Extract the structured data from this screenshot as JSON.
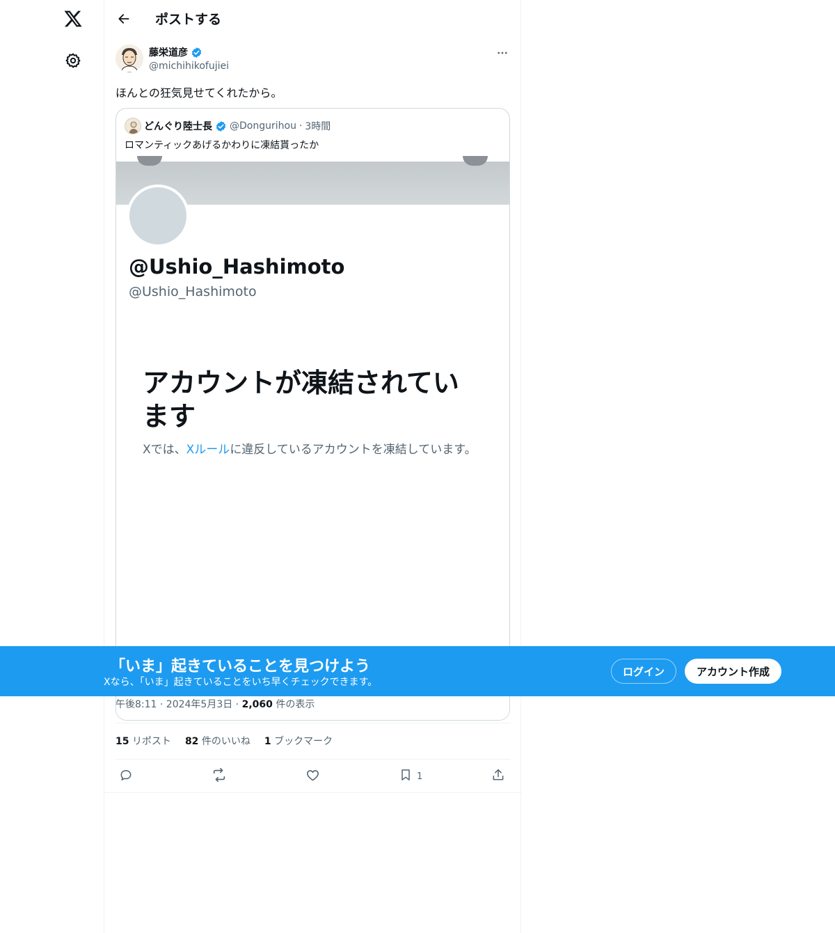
{
  "header": {
    "title": "ポストする"
  },
  "post": {
    "author_name": "藤栄道彦",
    "author_handle": "@michihikofujiei",
    "text": "ほんとの狂気見せてくれたから。",
    "timestamp": "午後8:11 · 2024年5月3日",
    "views_count": "2,060",
    "views_label": "件の表示",
    "reposts_count": "15",
    "reposts_label": "リポスト",
    "likes_count": "82",
    "likes_label": "件のいいね",
    "bookmarks_count": "1",
    "bookmarks_label": "ブックマーク",
    "bookmark_action_count": "1"
  },
  "quote": {
    "author_name": "どんぐり陸士長",
    "author_handle": "@Dongurihou",
    "separator": "·",
    "time": "3時間",
    "text": "ロマンティックあげるかわりに凍結貰ったか",
    "image": {
      "profile_name": "@Ushio_Hashimoto",
      "profile_handle": "@Ushio_Hashimoto",
      "suspended_title": "アカウントが凍結されています",
      "desc_prefix": "Xでは、",
      "desc_link": "Xルール",
      "desc_suffix": "に違反しているアカウントを凍結しています。"
    }
  },
  "login_bar": {
    "title": "「いま」起きていることを見つけよう",
    "subtitle": "Xなら、「いま」起きていることをいち早くチェックできます。",
    "login_label": "ログイン",
    "signup_label": "アカウント作成"
  },
  "colors": {
    "accent": "#1d9bf0",
    "text": "#0f1419",
    "muted": "#536471",
    "border": "#cfd9de"
  },
  "icons": [
    "x-logo-icon",
    "settings-gear-icon",
    "back-arrow-icon",
    "verified-badge-icon",
    "more-icon",
    "reply-icon",
    "repost-icon",
    "like-icon",
    "bookmark-icon",
    "share-icon"
  ]
}
